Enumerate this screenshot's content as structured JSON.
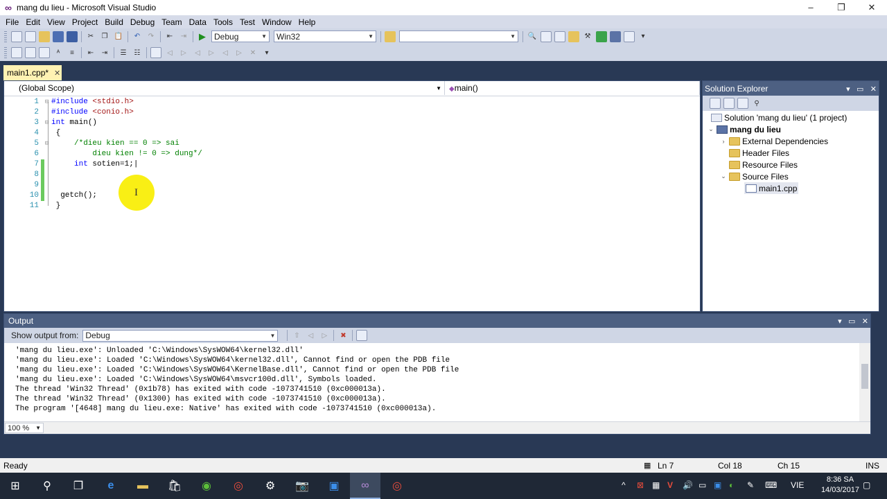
{
  "window": {
    "title": "mang du lieu - Microsoft Visual Studio",
    "min": "–",
    "max": "❐",
    "close": "✕"
  },
  "menu": [
    "File",
    "Edit",
    "View",
    "Project",
    "Build",
    "Debug",
    "Team",
    "Data",
    "Tools",
    "Test",
    "Window",
    "Help"
  ],
  "toolbar": {
    "config": "Debug",
    "platform": "Win32",
    "find_value": ""
  },
  "doc_tab": {
    "label": "main1.cpp*",
    "close": "✕"
  },
  "navbar": {
    "scope": "(Global Scope)",
    "function": "main()"
  },
  "code": {
    "lines": [
      {
        "n": "1",
        "parts": [
          [
            "pre",
            "#include "
          ],
          [
            "str",
            "<stdio.h>"
          ]
        ]
      },
      {
        "n": "2",
        "parts": [
          [
            "pre",
            "#include "
          ],
          [
            "str",
            "<conio.h>"
          ]
        ]
      },
      {
        "n": "3",
        "parts": [
          [
            "kw",
            "int"
          ],
          [
            "txt",
            " main()"
          ]
        ]
      },
      {
        "n": "4",
        "parts": [
          [
            "txt",
            " {"
          ]
        ]
      },
      {
        "n": "5",
        "parts": [
          [
            "cmt",
            "     /*dieu kien == 0 => sai"
          ]
        ]
      },
      {
        "n": "6",
        "parts": [
          [
            "cmt",
            "         dieu kien != 0 => dung*/"
          ]
        ]
      },
      {
        "n": "7",
        "parts": [
          [
            "txt",
            "     "
          ],
          [
            "kw",
            "int"
          ],
          [
            "txt",
            " sotien=1;|"
          ]
        ]
      },
      {
        "n": "8",
        "parts": []
      },
      {
        "n": "9",
        "parts": []
      },
      {
        "n": "10",
        "parts": [
          [
            "txt",
            "  getch();"
          ]
        ]
      },
      {
        "n": "11",
        "parts": [
          [
            "txt",
            " }"
          ]
        ]
      }
    ]
  },
  "solution_explorer": {
    "title": "Solution Explorer",
    "solution": "Solution 'mang du lieu' (1 project)",
    "project": "mang du lieu",
    "items": {
      "ext_deps": "External Dependencies",
      "header": "Header Files",
      "resource": "Resource Files",
      "source": "Source Files",
      "file": "main1.cpp"
    }
  },
  "output": {
    "title": "Output",
    "show_from_label": "Show output from:",
    "show_from_value": "Debug",
    "lines": [
      "'mang du lieu.exe': Unloaded 'C:\\Windows\\SysWOW64\\kernel32.dll'",
      "'mang du lieu.exe': Loaded 'C:\\Windows\\SysWOW64\\kernel32.dll', Cannot find or open the PDB file",
      "'mang du lieu.exe': Loaded 'C:\\Windows\\SysWOW64\\KernelBase.dll', Cannot find or open the PDB file",
      "'mang du lieu.exe': Loaded 'C:\\Windows\\SysWOW64\\msvcr100d.dll', Symbols loaded.",
      "The thread 'Win32 Thread' (0x1b78) has exited with code -1073741510 (0xc000013a).",
      "The thread 'Win32 Thread' (0x1300) has exited with code -1073741510 (0xc000013a).",
      "The program '[4648] mang du lieu.exe: Native' has exited with code -1073741510 (0xc000013a)."
    ],
    "zoom": "100 %"
  },
  "status": {
    "ready": "Ready",
    "line": "Ln 7",
    "col": "Col 18",
    "ch": "Ch 15",
    "mode": "INS"
  },
  "taskbar": {
    "lang": "VIE",
    "time": "8:36 SA",
    "date": "14/03/2017"
  },
  "colors": {
    "accent": "#293955",
    "panel_title": "#4d6082",
    "active_tab": "#fff2b3",
    "highlight": "#f9ef15"
  }
}
